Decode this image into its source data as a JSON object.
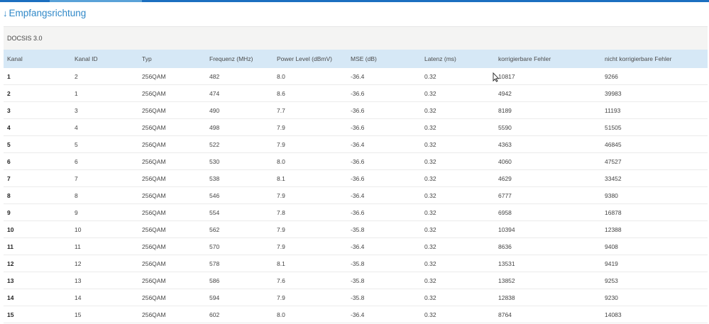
{
  "section": {
    "title": "Empfangsrichtung",
    "arrow_icon": "arrow-down-icon"
  },
  "panel": {
    "heading": "DOCSIS 3.0"
  },
  "table": {
    "headers": [
      "Kanal",
      "Kanal ID",
      "Typ",
      "Frequenz (MHz)",
      "Power Level (dBmV)",
      "MSE (dB)",
      "Latenz (ms)",
      "korrigierbare Fehler",
      "nicht korrigierbare Fehler"
    ],
    "rows": [
      [
        "1",
        "2",
        "256QAM",
        "482",
        "8.0",
        "-36.4",
        "0.32",
        "10817",
        "9266"
      ],
      [
        "2",
        "1",
        "256QAM",
        "474",
        "8.6",
        "-36.6",
        "0.32",
        "4942",
        "39983"
      ],
      [
        "3",
        "3",
        "256QAM",
        "490",
        "7.7",
        "-36.6",
        "0.32",
        "8189",
        "11193"
      ],
      [
        "4",
        "4",
        "256QAM",
        "498",
        "7.9",
        "-36.6",
        "0.32",
        "5590",
        "51505"
      ],
      [
        "5",
        "5",
        "256QAM",
        "522",
        "7.9",
        "-36.4",
        "0.32",
        "4363",
        "46845"
      ],
      [
        "6",
        "6",
        "256QAM",
        "530",
        "8.0",
        "-36.6",
        "0.32",
        "4060",
        "47527"
      ],
      [
        "7",
        "7",
        "256QAM",
        "538",
        "8.1",
        "-36.6",
        "0.32",
        "4629",
        "33452"
      ],
      [
        "8",
        "8",
        "256QAM",
        "546",
        "7.9",
        "-36.4",
        "0.32",
        "6777",
        "9380"
      ],
      [
        "9",
        "9",
        "256QAM",
        "554",
        "7.8",
        "-36.6",
        "0.32",
        "6958",
        "16878"
      ],
      [
        "10",
        "10",
        "256QAM",
        "562",
        "7.9",
        "-35.8",
        "0.32",
        "10394",
        "12388"
      ],
      [
        "11",
        "11",
        "256QAM",
        "570",
        "7.9",
        "-36.4",
        "0.32",
        "8636",
        "9408"
      ],
      [
        "12",
        "12",
        "256QAM",
        "578",
        "8.1",
        "-35.8",
        "0.32",
        "13531",
        "9419"
      ],
      [
        "13",
        "13",
        "256QAM",
        "586",
        "7.6",
        "-35.8",
        "0.32",
        "13852",
        "9253"
      ],
      [
        "14",
        "14",
        "256QAM",
        "594",
        "7.9",
        "-35.8",
        "0.32",
        "12838",
        "9230"
      ],
      [
        "15",
        "15",
        "256QAM",
        "602",
        "8.0",
        "-36.4",
        "0.32",
        "8764",
        "14083"
      ]
    ]
  },
  "colors": {
    "accent": "#2f88c8",
    "header_bg": "#d6e8f6",
    "panel_head_bg": "#f4f4f3"
  }
}
